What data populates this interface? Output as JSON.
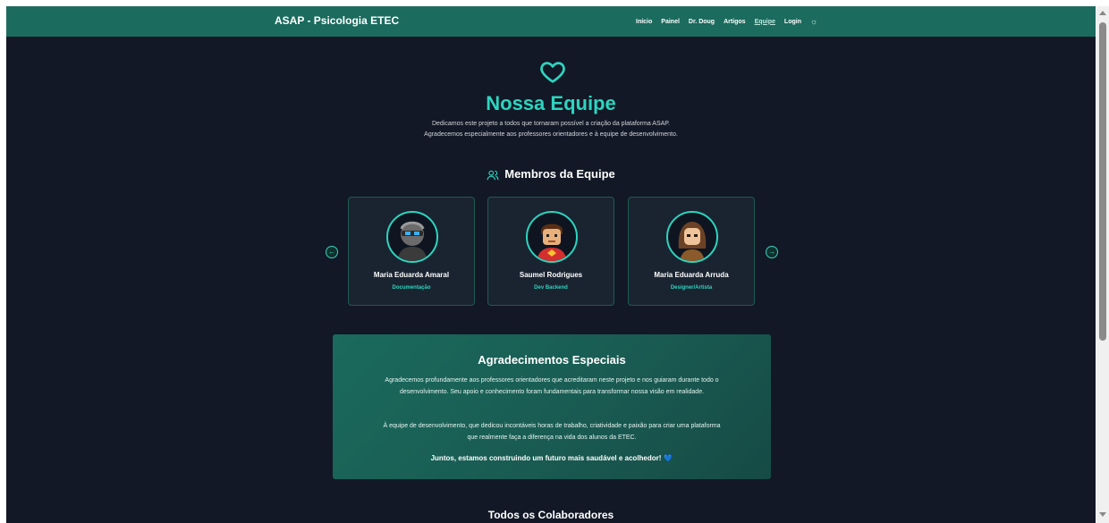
{
  "header": {
    "brand": "ASAP - Psicologia ETEC",
    "nav": [
      "Início",
      "Painel",
      "Dr. Doug",
      "Artigos",
      "Equipe",
      "Login"
    ],
    "active_nav": "Equipe",
    "theme_icon": "sun-icon"
  },
  "hero": {
    "icon": "heart-icon",
    "title": "Nossa Equipe",
    "subtitle_line1": "Dedicamos este projeto a todos que tornaram possível a criação da plataforma ASAP.",
    "subtitle_line2": "Agradecemos especialmente aos professores orientadores e à equipe de desenvolvimento."
  },
  "members": {
    "title": "Membros da Equipe",
    "icon": "users-icon",
    "prev_icon": "arrow-left-icon",
    "next_icon": "arrow-right-icon",
    "cards": [
      {
        "name": "Maria Eduarda Amaral",
        "role": "Documentação"
      },
      {
        "name": "Saumel Rodrigues",
        "role": "Dev Backend"
      },
      {
        "name": "Maria Eduarda Arruda",
        "role": "Designer/Artista"
      }
    ]
  },
  "thanks": {
    "title": "Agradecimentos Especiais",
    "p1": "Agradecemos profundamente aos professores orientadores que acreditaram neste projeto e nos guiaram durante todo o desenvolvimento. Seu apoio e conhecimento foram fundamentais para transformar nossa visão em realidade.",
    "p2": "À equipe de desenvolvimento, que dedicou incontáveis horas de trabalho, criatividade e paixão para criar uma plataforma que realmente faça a diferença na vida dos alunos da ETEC.",
    "closing": "Juntos, estamos construindo um futuro mais saudável e acolhedor!",
    "closing_emoji": "💙"
  },
  "collaborators": {
    "title": "Todos os Colaboradores"
  },
  "colors": {
    "accent": "#2dd4bf",
    "header_bg": "#1b6b5e",
    "page_bg": "#121826",
    "card_bg": "#1a2431"
  }
}
